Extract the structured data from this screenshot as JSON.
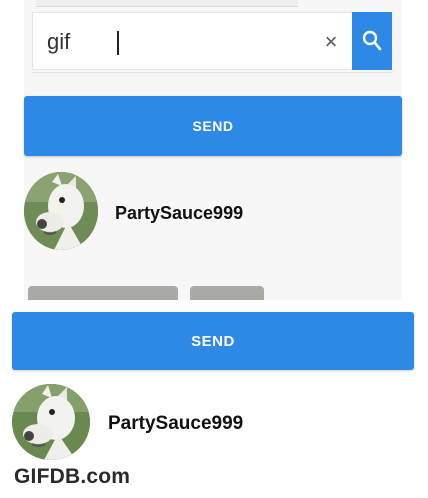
{
  "search": {
    "value": "gif",
    "clear_label": "×"
  },
  "actions": {
    "send_label_top": "SEND",
    "send_label_bottom": "SEND"
  },
  "users": [
    {
      "name": "PartySauce999"
    },
    {
      "name": "PartySauce999"
    }
  ],
  "watermark": "GIFDB.com",
  "colors": {
    "accent": "#2d88e6",
    "pill": "#a9aaa5"
  },
  "icons": [
    "search-icon",
    "clear-icon"
  ]
}
